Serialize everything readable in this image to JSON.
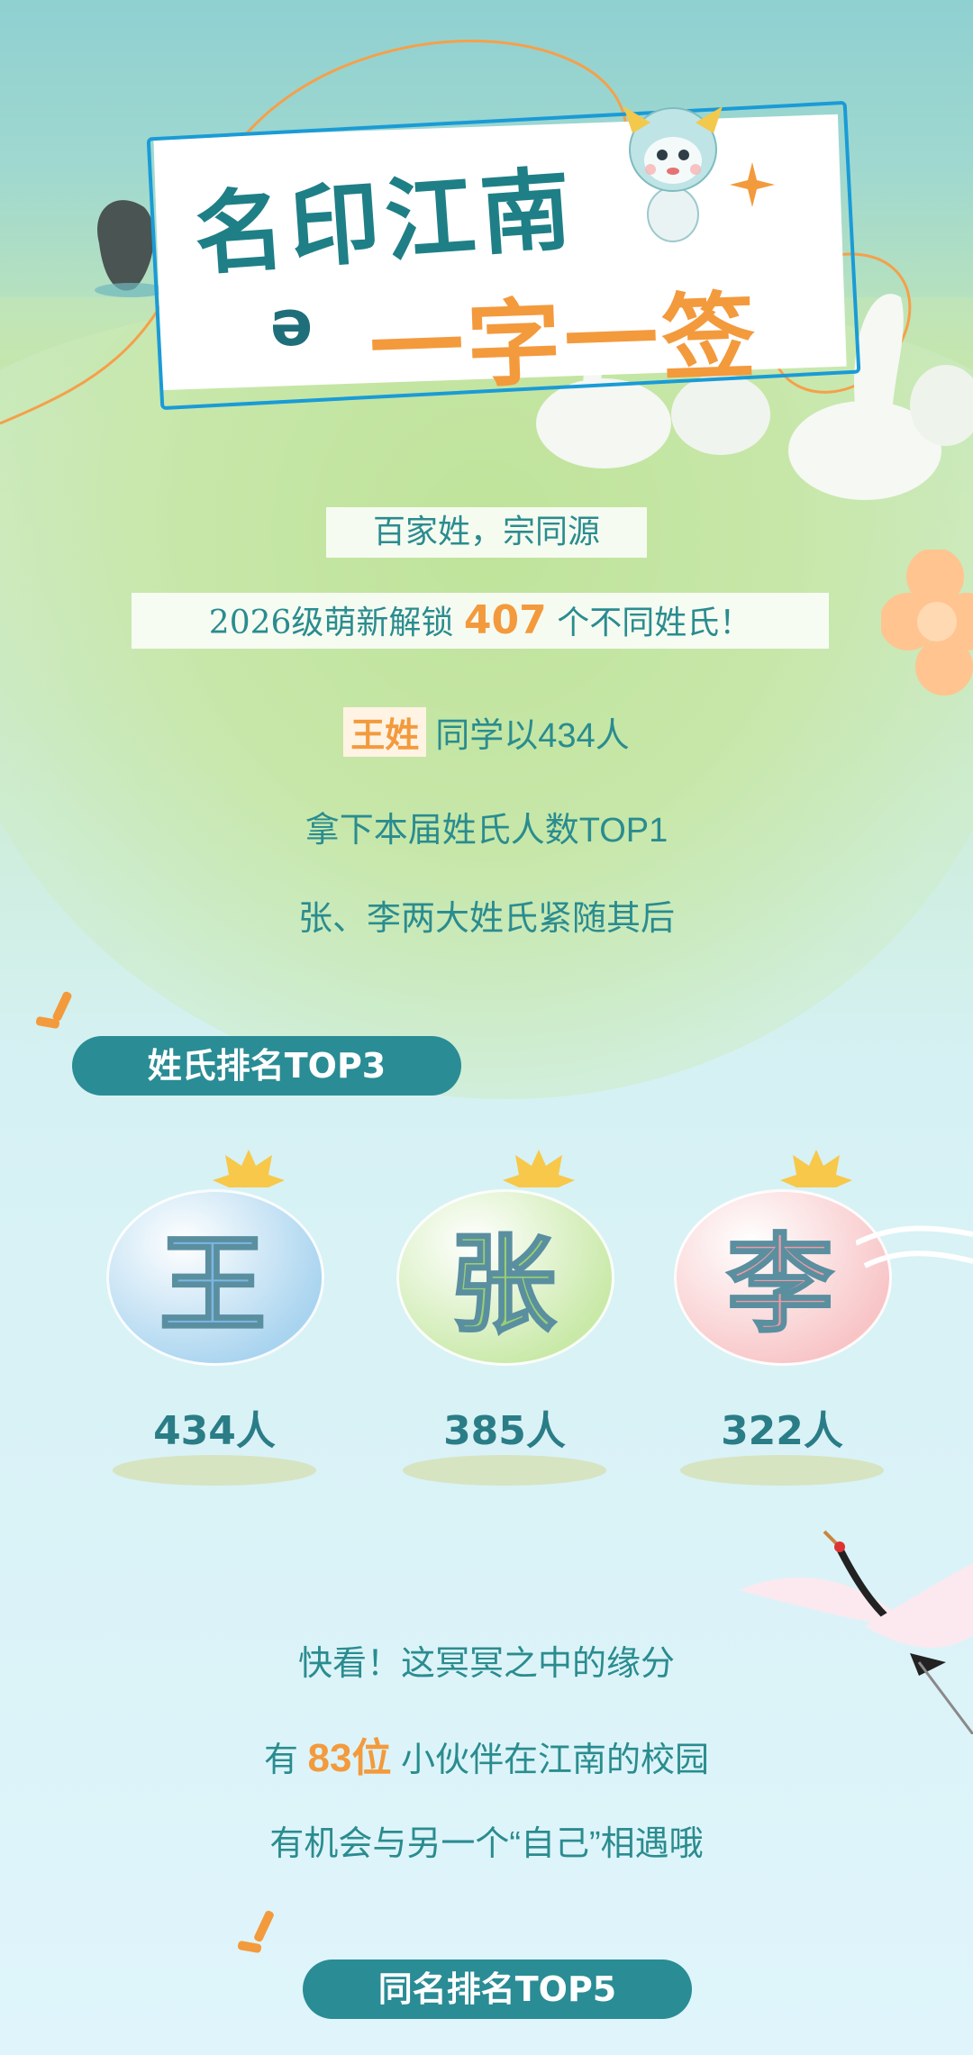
{
  "header": {
    "title_line1": "名印江南",
    "title_line2": "一字一签",
    "curl_glyph": "ə"
  },
  "intro": {
    "subtitle": "百家姓，宗同源",
    "count_prefix": "2026级萌新解锁",
    "count_number": "407",
    "count_suffix": "个不同姓氏！"
  },
  "summary": {
    "line1_tag": "王姓",
    "line1_text": "同学以434人",
    "line2": "拿下本届姓氏人数TOP1",
    "line3": "张、李两大姓氏紧随其后"
  },
  "surname_section": {
    "pill_label": "姓氏排名TOP3",
    "items": [
      {
        "char": "王",
        "count": "434人",
        "color": "#a9d4ef",
        "text_color": "#7cb6e3"
      },
      {
        "char": "张",
        "count": "385人",
        "color": "#c9e9a8",
        "text_color": "#98cf72"
      },
      {
        "char": "李",
        "count": "322人",
        "color": "#f8c5c7",
        "text_color": "#f29aa2"
      }
    ]
  },
  "fate": {
    "line1": "快看！这冥冥之中的缘分",
    "line2_prefix": "有",
    "line2_number": "83位",
    "line2_suffix": "小伙伴在江南的校园",
    "line3": "有机会与另一个“自己”相遇哦"
  },
  "samename_section": {
    "pill_label": "同名排名TOP5"
  },
  "colors": {
    "teal": "#2a8c95",
    "orange": "#f39a3d",
    "blue_border": "#1a9bd6"
  }
}
